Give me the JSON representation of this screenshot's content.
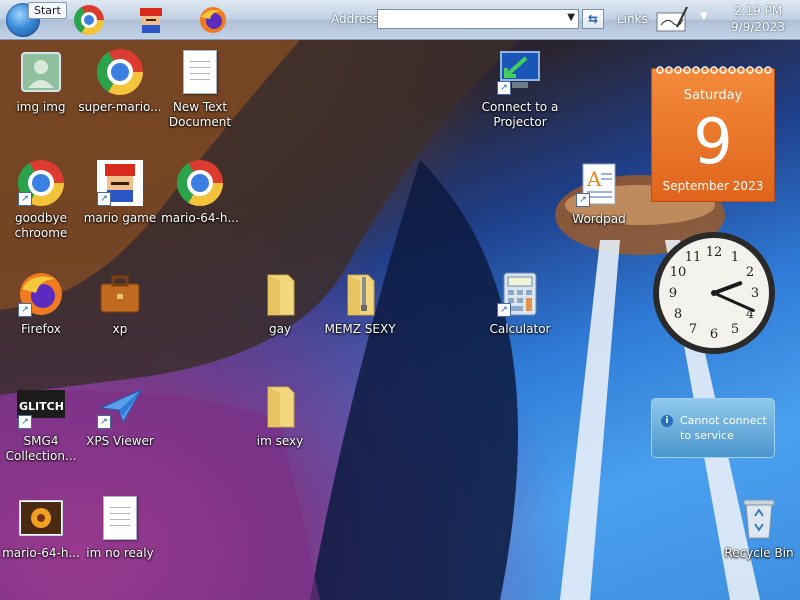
{
  "taskbar": {
    "start_tooltip": "Start",
    "pinned": [
      "chrome-icon",
      "mario-icon",
      "firefox-icon"
    ],
    "address_label": "Address",
    "address_value": "",
    "links_label": "Links",
    "time": "2:19 PM",
    "date": "9/9/2023"
  },
  "desktop_icons": [
    {
      "label": "img img",
      "icon": "user-picture-icon",
      "shortcut": false
    },
    {
      "label": "super-mario...",
      "icon": "chrome-icon",
      "shortcut": false
    },
    {
      "label": "New Text Document",
      "icon": "text-document-icon",
      "shortcut": false
    },
    {
      "label": "Connect to a Projector",
      "icon": "projector-icon",
      "shortcut": true
    },
    {
      "label": "goodbye chroome",
      "icon": "chrome-icon",
      "shortcut": true
    },
    {
      "label": "mario game",
      "icon": "mario-icon",
      "shortcut": true
    },
    {
      "label": "mario-64-h...",
      "icon": "chrome-icon",
      "shortcut": false
    },
    {
      "label": "Wordpad",
      "icon": "wordpad-icon",
      "shortcut": true
    },
    {
      "label": "Firefox",
      "icon": "firefox-icon",
      "shortcut": true
    },
    {
      "label": "xp",
      "icon": "briefcase-icon",
      "shortcut": false
    },
    {
      "label": "gay",
      "icon": "folder-icon",
      "shortcut": false
    },
    {
      "label": "MEMZ SEXY",
      "icon": "zip-folder-icon",
      "shortcut": false
    },
    {
      "label": "Calculator",
      "icon": "calculator-icon",
      "shortcut": true
    },
    {
      "label": "SMG4 Collection...",
      "icon": "glitch-icon",
      "shortcut": true
    },
    {
      "label": "XPS Viewer",
      "icon": "xps-viewer-icon",
      "shortcut": true
    },
    {
      "label": "im sexy",
      "icon": "folder-icon",
      "shortcut": false
    },
    {
      "label": "mario-64-h...",
      "icon": "flower-picture-icon",
      "shortcut": false
    },
    {
      "label": "im no realy",
      "icon": "text-document-icon",
      "shortcut": false
    },
    {
      "label": "Recycle Bin",
      "icon": "recycle-bin-icon",
      "shortcut": false
    }
  ],
  "gadgets": {
    "calendar": {
      "weekday": "Saturday",
      "day": "9",
      "month_year": "September 2023"
    },
    "clock": {
      "hour": 2,
      "minute": 19
    },
    "notice": {
      "text": "Cannot connect to service"
    }
  },
  "colors": {
    "calendar_bg": "#e8721f",
    "taskbar_bg": "#c3d3e6",
    "notice_bg": "#5aa2d6"
  }
}
